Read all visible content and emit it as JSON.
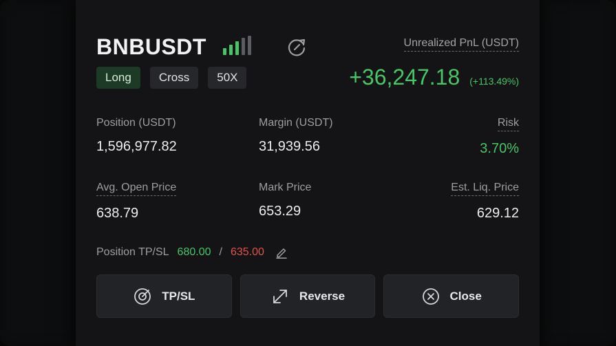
{
  "position": {
    "symbol": "BNBUSDT",
    "tags": {
      "side": "Long",
      "margin_mode": "Cross",
      "leverage": "50X"
    },
    "unrealized_pnl": {
      "label": "Unrealized PnL (USDT)",
      "value": "+36,247.18",
      "percent": "(+113.49%)"
    },
    "fields": {
      "position_usdt": {
        "label": "Position (USDT)",
        "value": "1,596,977.82"
      },
      "margin_usdt": {
        "label": "Margin (USDT)",
        "value": "31,939.56"
      },
      "risk": {
        "label": "Risk",
        "value": "3.70%"
      },
      "avg_open_price": {
        "label": "Avg. Open Price",
        "value": "638.79"
      },
      "mark_price": {
        "label": "Mark Price",
        "value": "653.29"
      },
      "est_liq_price": {
        "label": "Est. Liq. Price",
        "value": "629.12"
      }
    },
    "tpsl": {
      "label": "Position TP/SL",
      "tp": "680.00",
      "separator": "/",
      "sl": "635.00"
    }
  },
  "actions": {
    "tpsl_label": "TP/SL",
    "reverse_label": "Reverse",
    "close_label": "Close"
  },
  "colors": {
    "profit": "#48c567",
    "loss": "#e2524d",
    "panel_bg": "#141416",
    "button_bg": "#222326",
    "long_tag_bg": "#1d3a27"
  },
  "icons": {
    "signal": "signal-strength-icon",
    "refresh": "share-refresh-icon",
    "edit": "pencil-edit-icon",
    "tpsl": "target-icon",
    "reverse": "expand-arrows-icon",
    "close": "circle-x-icon"
  }
}
